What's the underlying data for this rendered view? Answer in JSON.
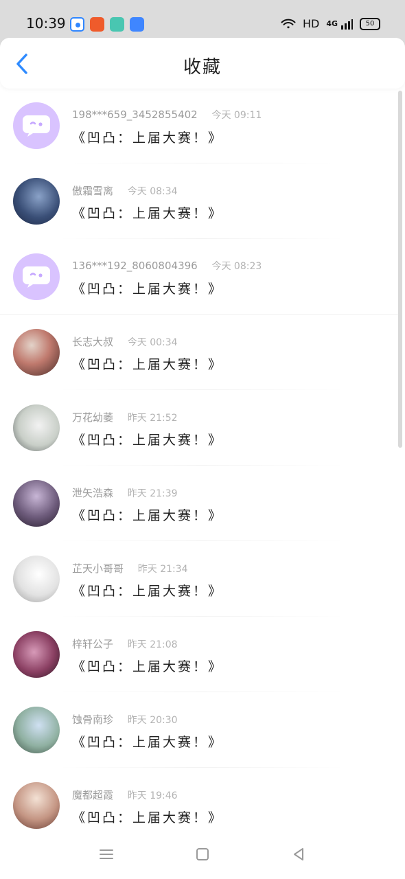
{
  "status_bar": {
    "time": "10:39",
    "right_network": "HD",
    "signal": "4G",
    "battery_level": "50",
    "app_icon_colors": [
      "#2f86ff",
      "#ef5b2b",
      "#49c6b1",
      "#3f86ff"
    ]
  },
  "header": {
    "title": "收藏",
    "back_icon_color": "#2f8bff"
  },
  "items": [
    {
      "username": "198***659_3452855402",
      "time": "今天 09:11",
      "content": "《凹凸：上届大赛！》",
      "avatar_type": "chat-bubble"
    },
    {
      "username": "傲霜雪离",
      "time": "今天 08:34",
      "content": "《凹凸：上届大赛！》",
      "avatar_type": "photo"
    },
    {
      "username": "136***192_8060804396",
      "time": "今天 08:23",
      "content": "《凹凸：上届大赛！》",
      "avatar_type": "chat-bubble"
    },
    {
      "username": "长志大叔",
      "time": "今天 00:34",
      "content": "《凹凸：上届大赛！》",
      "avatar_type": "photo"
    },
    {
      "username": "万花幼萎",
      "time": "昨天 21:52",
      "content": "《凹凸：上届大赛！》",
      "avatar_type": "photo"
    },
    {
      "username": "泄矢浩森",
      "time": "昨天 21:39",
      "content": "《凹凸：上届大赛！》",
      "avatar_type": "photo"
    },
    {
      "username": "芷天小哥哥",
      "time": "昨天 21:34",
      "content": "《凹凸：上届大赛！》",
      "avatar_type": "photo"
    },
    {
      "username": "梓轩公子",
      "time": "昨天 21:08",
      "content": "《凹凸：上届大赛！》",
      "avatar_type": "photo"
    },
    {
      "username": "蚀骨南珍",
      "time": "昨天 20:30",
      "content": "《凹凸：上届大赛！》",
      "avatar_type": "photo"
    },
    {
      "username": "魔都超霞",
      "time": "昨天 19:46",
      "content": "《凹凸：上届大赛！》",
      "avatar_type": "photo"
    }
  ],
  "nav": {
    "icons": [
      "menu-icon",
      "home-icon",
      "back-icon"
    ]
  },
  "colors": {
    "accent": "#2f8bff",
    "muted_text": "#9b9b9b",
    "chat_avatar_bg": "#d9c3ff"
  }
}
